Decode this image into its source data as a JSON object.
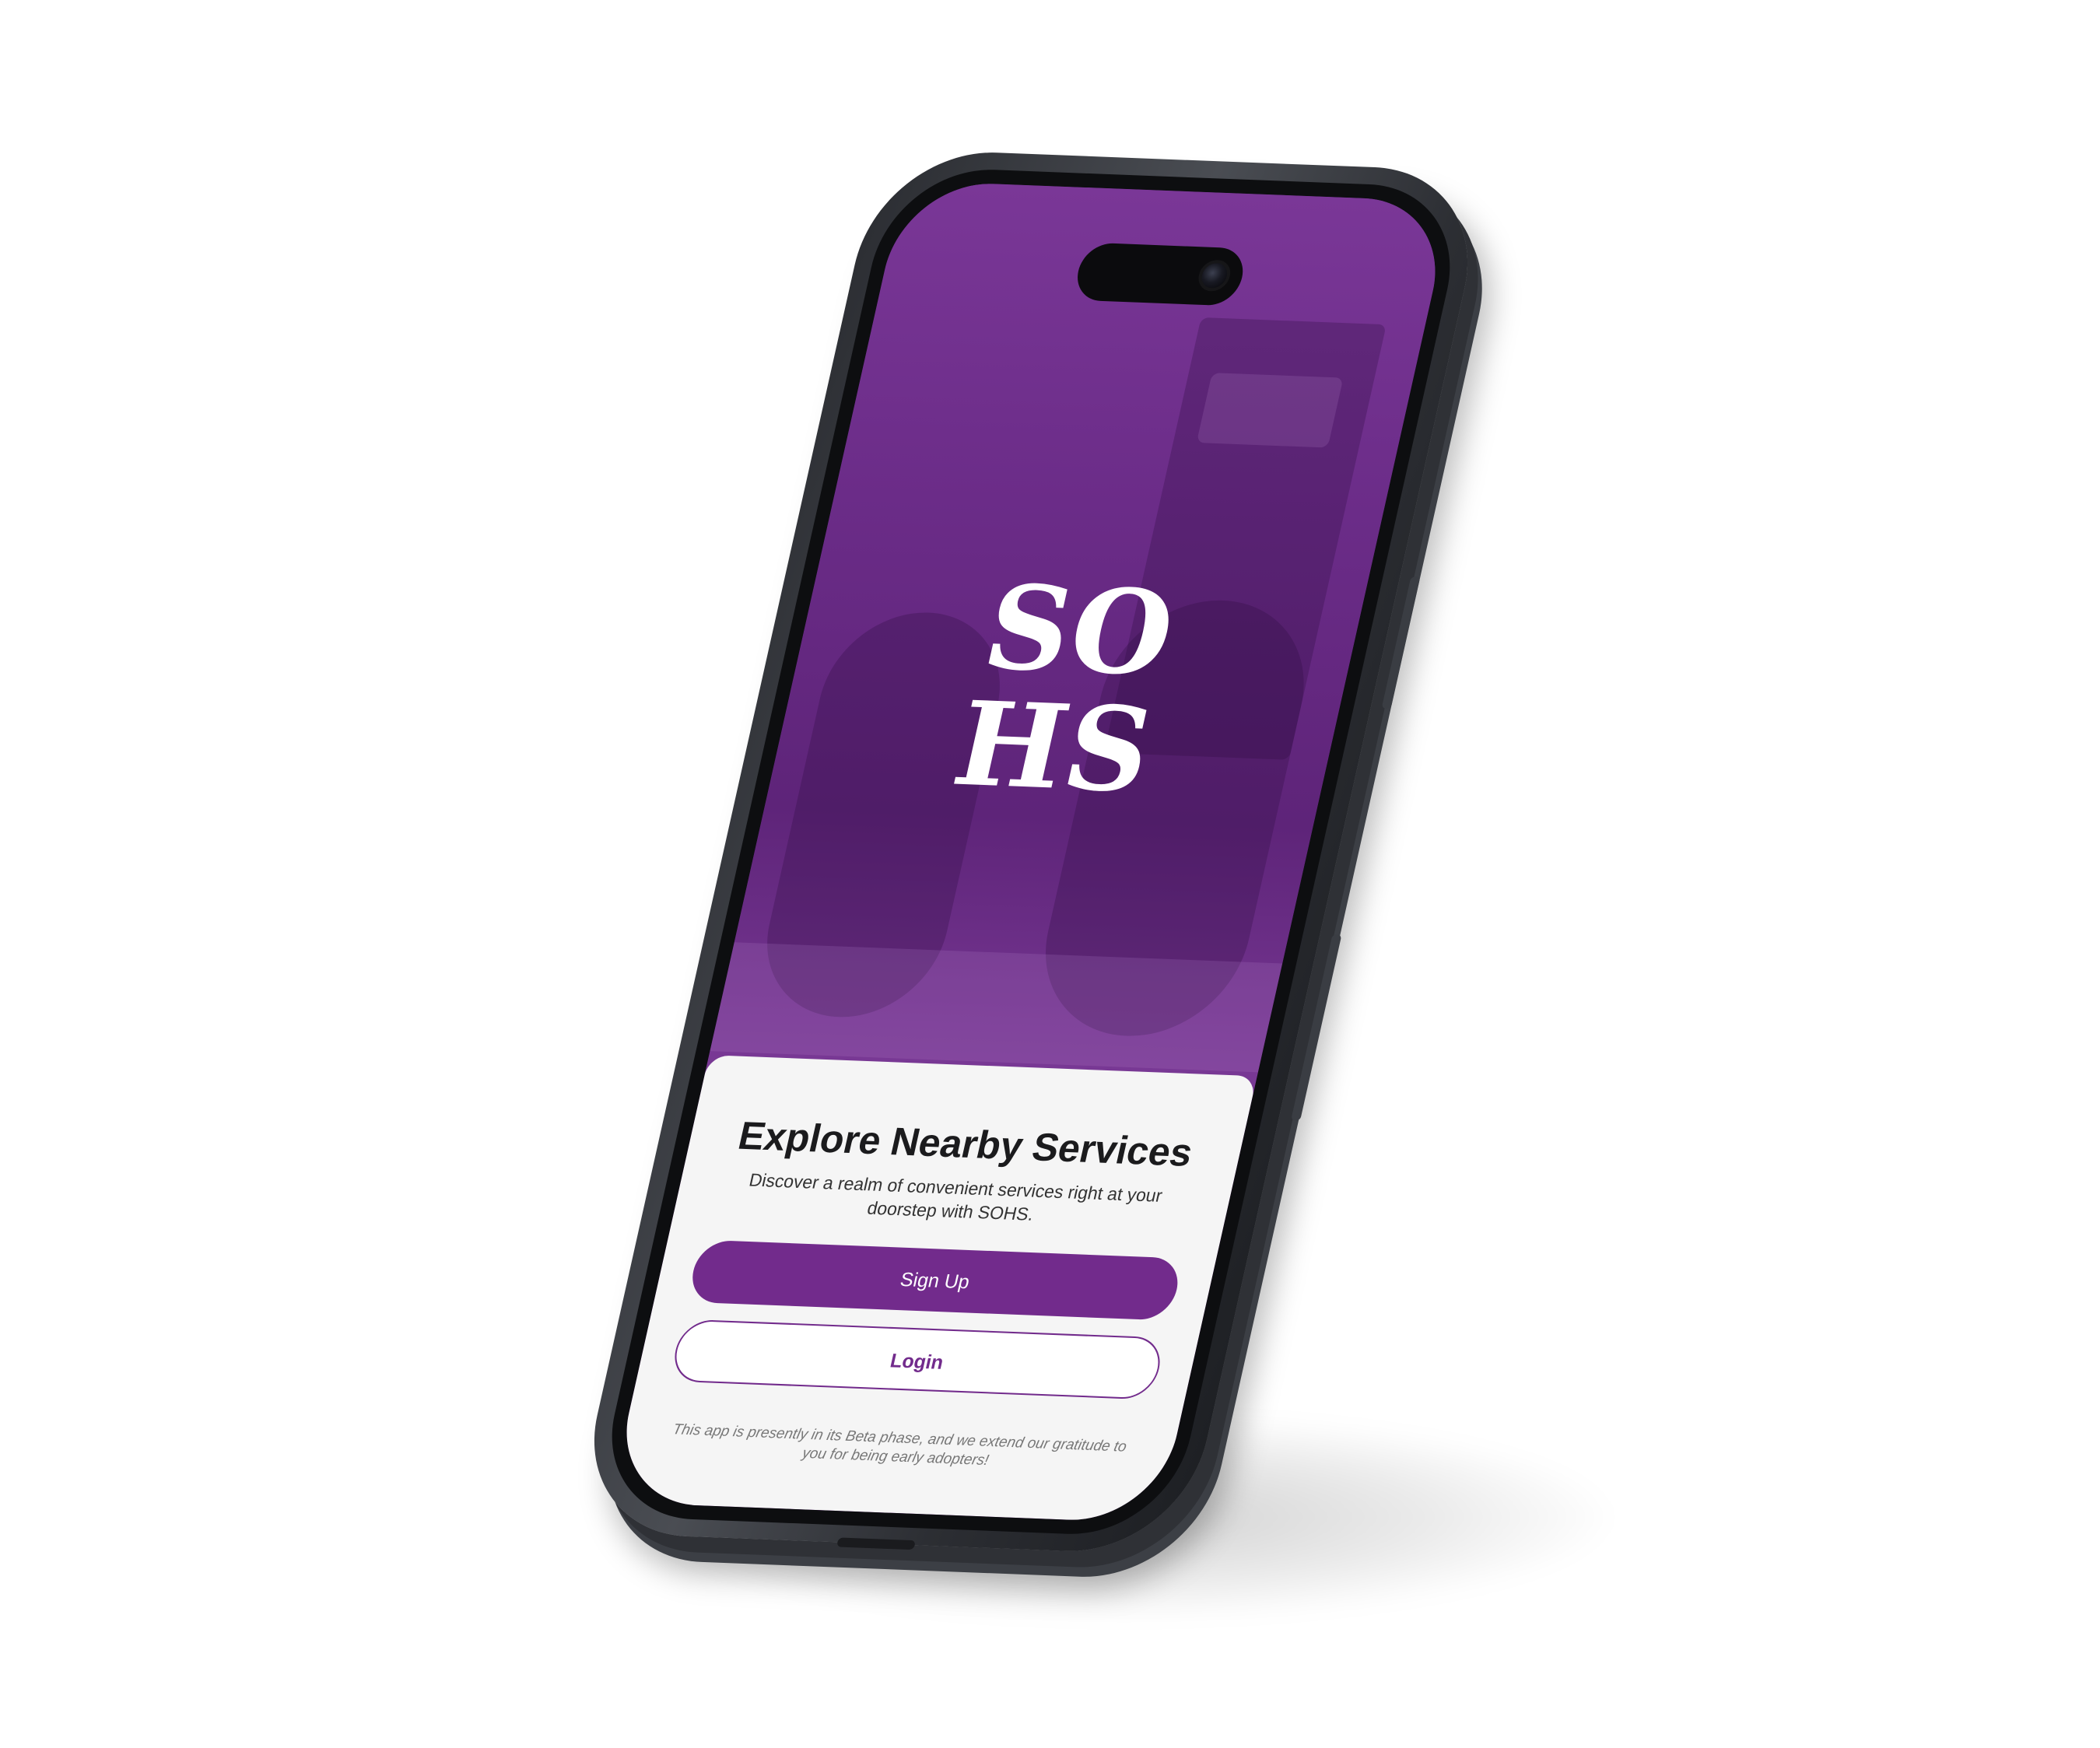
{
  "brand": {
    "logo_line1": "SO",
    "logo_line2": "HS",
    "accent_color": "#722b8c"
  },
  "welcome": {
    "title": "Explore Nearby Services",
    "subtitle": "Discover a realm of convenient services right at your doorstep with SOHS."
  },
  "actions": {
    "signup_label": "Sign Up",
    "login_label": "Login"
  },
  "footer": {
    "note": "This app is presently in its Beta phase, and we extend our gratitude to you for being early adopters!"
  },
  "icons": {
    "camera": "front-camera-icon"
  }
}
